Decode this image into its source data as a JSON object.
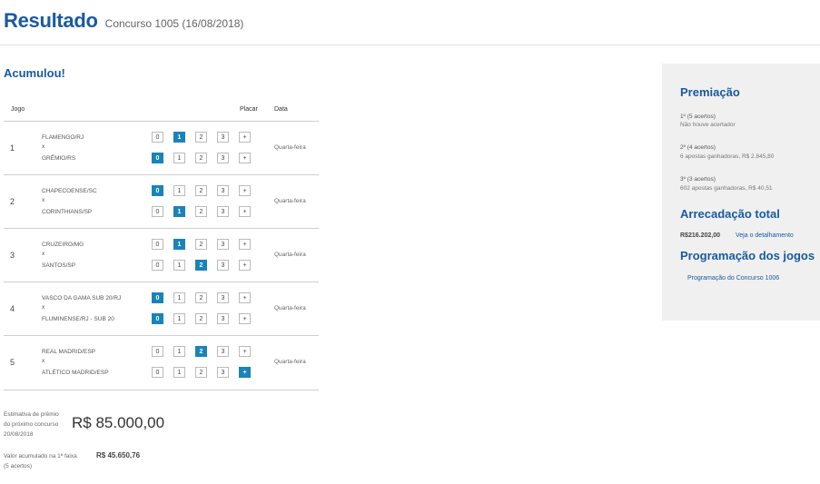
{
  "header": {
    "title": "Resultado",
    "subtitle": "Concurso 1005 (16/08/2018)"
  },
  "status": "Acumulou!",
  "table": {
    "headers": {
      "jogo": "Jogo",
      "placar": "Placar",
      "data": "Data"
    },
    "options": [
      "0",
      "1",
      "2",
      "3",
      "+"
    ],
    "games": [
      {
        "num": "1",
        "home": "FLAMENGO/RJ",
        "vs": "x",
        "away": "GRÊMIO/RS",
        "home_score": "1",
        "away_score": "0",
        "date": "Quarta-feira"
      },
      {
        "num": "2",
        "home": "CHAPECOENSE/SC",
        "vs": "x",
        "away": "CORINTHIANS/SP",
        "home_score": "0",
        "away_score": "1",
        "date": "Quarta-feira"
      },
      {
        "num": "3",
        "home": "CRUZEIRO/MG",
        "vs": "x",
        "away": "SANTOS/SP",
        "home_score": "1",
        "away_score": "2",
        "date": "Quarta-feira"
      },
      {
        "num": "4",
        "home": "VASCO DA GAMA SUB 20/RJ",
        "vs": "x",
        "away": "FLUMINENSE/RJ - SUB 20",
        "home_score": "0",
        "away_score": "0",
        "date": "Quarta-feira"
      },
      {
        "num": "5",
        "home": "REAL MADRID/ESP",
        "vs": "x",
        "away": "ATLÉTICO MADRID/ESP",
        "home_score": "2",
        "away_score": "+",
        "date": "Quarta-feira"
      }
    ]
  },
  "estimate": {
    "label_line1": "Estimativa de prêmio",
    "label_line2": "do próximo concurso",
    "label_line3": "20/08/2018",
    "value": "R$ 85.000,00"
  },
  "accumulated": {
    "label_line1": "Valor acumulado na 1ª faixa",
    "label_line2": "(5 acertos)",
    "value": "R$ 45.650,76"
  },
  "sidebar": {
    "premiacao_title": "Premiação",
    "prizes": [
      {
        "tier": "1º (5 acertos)",
        "detail": "Não houve acertador"
      },
      {
        "tier": "2º (4 acertos)",
        "detail": "6 apostas ganhadoras, R$ 2.845,80"
      },
      {
        "tier": "3º (3 acertos)",
        "detail": "602 apostas ganhadoras, R$ 40,51"
      }
    ],
    "arrecadacao_title": "Arrecadação total",
    "arrecadacao_value": "R$216.202,00",
    "arrecadacao_link": "Veja o detalhamento",
    "programacao_title": "Programação dos jogos",
    "programacao_link": "Programação do Concurso 1006"
  },
  "colors": {
    "brand": "#1a5aa0",
    "selected": "#1a84b8",
    "sidebar_bg": "#f0f0f0"
  }
}
